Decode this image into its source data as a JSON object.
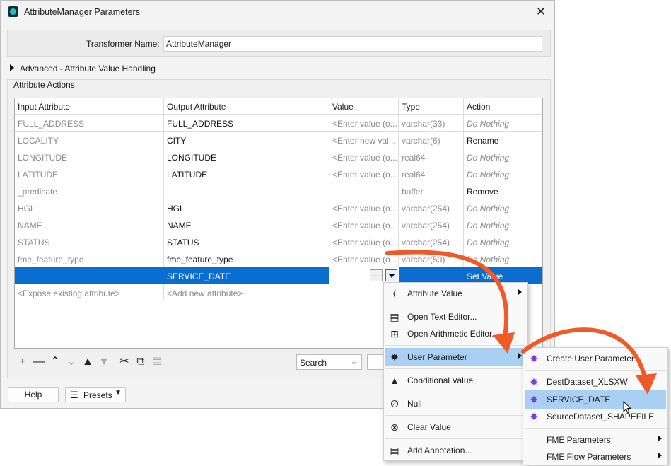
{
  "window": {
    "title": "AttributeManager Parameters",
    "close_glyph": "✕"
  },
  "transformer": {
    "label": "Transformer Name:",
    "value": "AttributeManager"
  },
  "advanced": {
    "label": "Advanced - Attribute Value Handling"
  },
  "group": {
    "label": "Attribute Actions"
  },
  "table": {
    "headers": [
      "Input Attribute",
      "Output Attribute",
      "Value",
      "Type",
      "Action"
    ],
    "rows": [
      {
        "input": "FULL_ADDRESS",
        "output": "FULL_ADDRESS",
        "value": "<Enter value (o...",
        "type": "varchar(33)",
        "action": "Do Nothing"
      },
      {
        "input": "LOCALITY",
        "output": "CITY",
        "value": "<Enter new val...",
        "type": "varchar(6)",
        "action": "Rename"
      },
      {
        "input": "LONGITUDE",
        "output": "LONGITUDE",
        "value": "<Enter value (o...",
        "type": "real64",
        "action": "Do Nothing"
      },
      {
        "input": "LATITUDE",
        "output": "LATITUDE",
        "value": "<Enter value (o...",
        "type": "real64",
        "action": "Do Nothing"
      },
      {
        "input": "_predicate",
        "output": "",
        "value": "",
        "type": "buffer",
        "action": "Remove"
      },
      {
        "input": "HGL",
        "output": "HGL",
        "value": "<Enter value (o...",
        "type": "varchar(254)",
        "action": "Do Nothing"
      },
      {
        "input": "NAME",
        "output": "NAME",
        "value": "<Enter value (o...",
        "type": "varchar(254)",
        "action": "Do Nothing"
      },
      {
        "input": "STATUS",
        "output": "STATUS",
        "value": "<Enter value (o...",
        "type": "varchar(254)",
        "action": "Do Nothing"
      },
      {
        "input": "fme_feature_type",
        "output": "fme_feature_type",
        "value": "<Enter value (o...",
        "type": "varchar(50)",
        "action": "Do Nothing"
      },
      {
        "input": "",
        "output": "SERVICE_DATE",
        "value": "",
        "type": "",
        "action": "Set Value"
      },
      {
        "input": "<Expose existing attribute>",
        "output": "<Add new attribute>",
        "value": "",
        "type": "",
        "action": ""
      }
    ],
    "ellipsis_label": "..."
  },
  "toolbar": {
    "search_label": "Search"
  },
  "buttons": {
    "help": "Help",
    "presets": "Presets"
  },
  "menu_value": {
    "items": [
      {
        "label": "Attribute Value",
        "icon": "attribute-value-icon"
      },
      {
        "label": "Open Text Editor...",
        "icon": "text-editor-icon"
      },
      {
        "label": "Open Arithmetic Editor...",
        "icon": "arithmetic-editor-icon"
      },
      {
        "label": "User Parameter",
        "icon": "user-parameter-icon"
      },
      {
        "label": "Conditional Value...",
        "icon": "conditional-value-icon"
      },
      {
        "label": "Null",
        "icon": "null-icon"
      },
      {
        "label": "Clear Value",
        "icon": "clear-value-icon"
      },
      {
        "label": "Add Annotation...",
        "icon": "annotation-icon"
      }
    ]
  },
  "menu_params": {
    "items": [
      {
        "label": "Create User Parameter..."
      },
      {
        "label": "DestDataset_XLSXW"
      },
      {
        "label": "SERVICE_DATE"
      },
      {
        "label": "SourceDataset_SHAPEFILE"
      },
      {
        "label": "FME Parameters"
      },
      {
        "label": "FME Flow Parameters"
      }
    ]
  },
  "colors": {
    "selection": "#0a6ed1",
    "menu_highlight": "#a9cff3",
    "annotation_arrow": "#f05a28",
    "parameter_icon": "#7b3fd3"
  }
}
